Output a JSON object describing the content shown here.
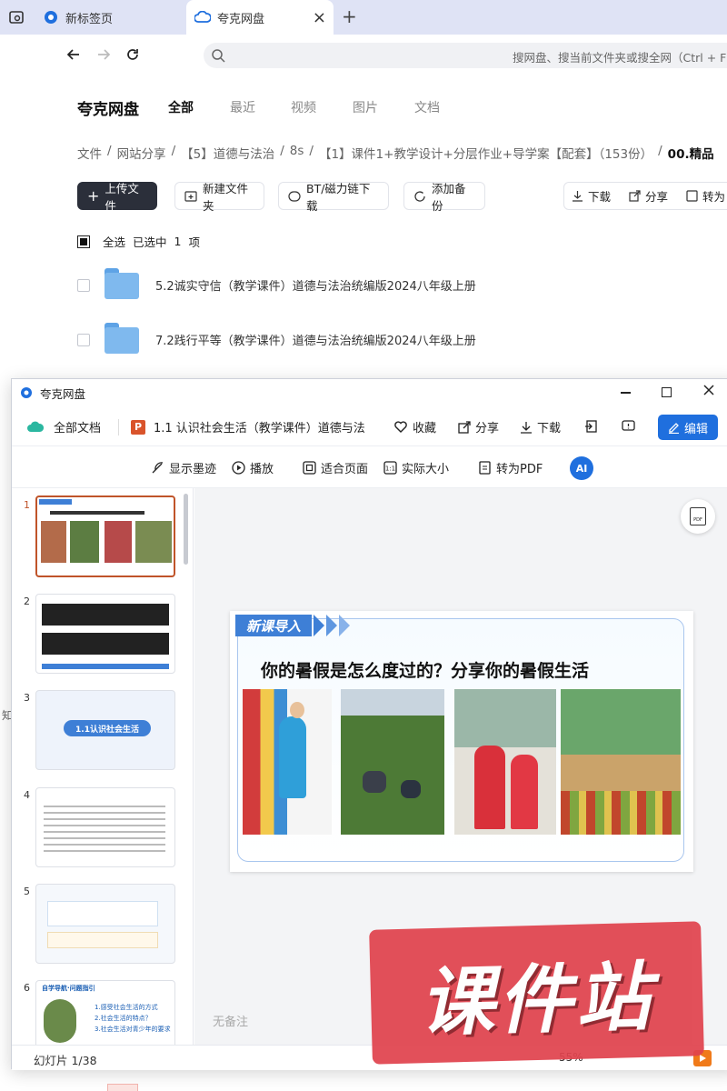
{
  "browser": {
    "tabs": [
      {
        "label": "新标签页",
        "icon": "browser-logo-icon"
      },
      {
        "label": "夸克网盘",
        "icon": "cloud-icon"
      }
    ],
    "new_tab": "+",
    "close": "×",
    "search_placeholder": "搜网盘、搜当前文件夹或搜全网（Ctrl + F"
  },
  "disk": {
    "logo": "夸克网盘",
    "nav": [
      "全部",
      "最近",
      "视频",
      "图片",
      "文档"
    ],
    "breadcrumb": [
      "文件",
      "网站分享",
      "【5】道德与法治",
      "8s",
      "【1】课件1+教学设计+分层作业+导学案【配套】（153份）",
      "00.精品"
    ],
    "breadcrumb_sep": "/",
    "actions": {
      "upload": "上传文件",
      "new_folder": "新建文件夹",
      "bt": "BT/磁力链下载",
      "backup": "添加备份",
      "download": "下载",
      "share": "分享",
      "convert": "转为"
    },
    "selection": {
      "select_all": "全选",
      "selected": "已选中",
      "count": "1",
      "unit": "项"
    },
    "files": [
      {
        "name": "5.2诚实守信（教学课件）道德与法治统编版2024八年级上册"
      },
      {
        "name": "7.2践行平等（教学课件）道德与法治统编版2024八年级上册"
      }
    ]
  },
  "viewer": {
    "title": "夸克网盘",
    "all_docs": "全部文档",
    "doc_title": "1.1 认识社会生活（教学课件）道德与法",
    "favorite": "收藏",
    "share": "分享",
    "download": "下载",
    "edit": "编辑",
    "tools": [
      "显示墨迹",
      "播放",
      "适合页面",
      "实际大小",
      "转为PDF"
    ],
    "ai": "AI",
    "slide_numbers": [
      "1",
      "2",
      "3",
      "4",
      "5",
      "6"
    ],
    "thumb3_title": "1.1认识社会生活",
    "thumb6_items": [
      "1.感受社会生活的方式",
      "2.社会生活的特点？",
      "3.社会生活对青少年的要求"
    ],
    "thumb6_header": "自学导航·问题指引",
    "slide": {
      "banner": "新课导入",
      "question": "你的暑假是怎么度过的？分享你的暑假生活"
    },
    "notes_placeholder": "无备注",
    "status": "幻灯片 1/38",
    "zoom": "55%",
    "pdf_badge": "PDF"
  },
  "watermark": {
    "text": "课件站"
  },
  "side_char": "知",
  "colors": {
    "accent": "#1f6fde",
    "edit_button": "#1f6fde",
    "upload_button": "#2b2f3a",
    "watermark": "#e0434e",
    "banner": "#3e7fd6"
  }
}
